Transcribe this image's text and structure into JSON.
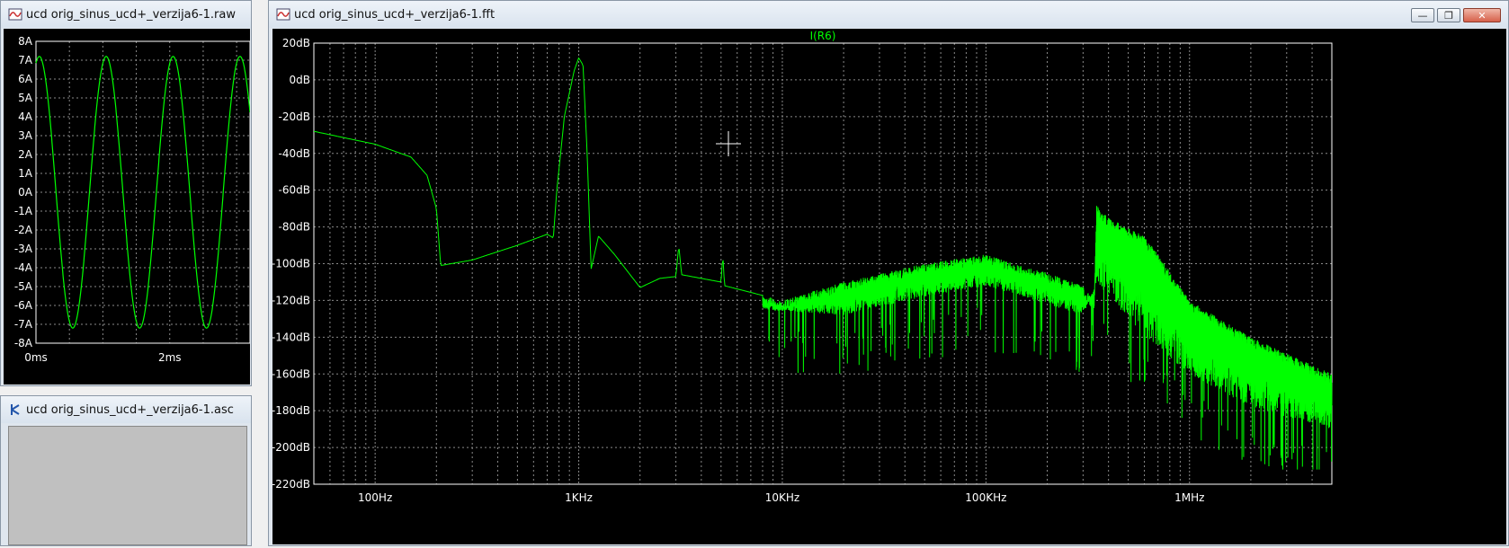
{
  "colors": {
    "trace": "#00ff00",
    "grid": "#8a8a8a",
    "axis_text": "#ffffff",
    "plot_bg": "#000000"
  },
  "windows": {
    "raw": {
      "title": "ucd orig_sinus_ucd+_verzija6-1.raw",
      "icon": "waveform-icon"
    },
    "asc": {
      "title": "ucd orig_sinus_ucd+_verzija6-1.asc",
      "icon": "schematic-icon"
    },
    "fft": {
      "title": "ucd orig_sinus_ucd+_verzija6-1.fft",
      "icon": "waveform-icon",
      "buttons": {
        "minimize": "minimize-button",
        "restore": "restore-button",
        "close": "close-button"
      }
    }
  },
  "chart_data": [
    {
      "type": "line",
      "window": "raw",
      "ylabel_ticks": [
        "8A",
        "7A",
        "6A",
        "5A",
        "4A",
        "3A",
        "2A",
        "1A",
        "0A",
        "-1A",
        "-2A",
        "-3A",
        "-4A",
        "-5A",
        "-6A",
        "-7A",
        "-8A"
      ],
      "xlabel_ticks": [
        "0ms",
        "2ms"
      ],
      "ylim": [
        -8,
        8
      ],
      "xlim": [
        0,
        3.2
      ],
      "series": [
        {
          "amplitude": 7.2,
          "period_ms": 1.0,
          "phase_peak_ms": 0.05
        }
      ]
    },
    {
      "type": "line",
      "window": "fft",
      "title": "I(R6)",
      "x_scale": "log",
      "xlim": [
        50,
        5000000
      ],
      "ylim": [
        -220,
        20
      ],
      "y_ticks": [
        "20dB",
        "0dB",
        "-20dB",
        "-40dB",
        "-60dB",
        "-80dB",
        "-100dB",
        "-120dB",
        "-140dB",
        "-160dB",
        "-180dB",
        "-200dB",
        "-220dB"
      ],
      "x_ticks": [
        "100Hz",
        "1KHz",
        "10KHz",
        "100KHz",
        "1MHz"
      ],
      "envelope": [
        [
          50,
          -28
        ],
        [
          100,
          -35
        ],
        [
          150,
          -42
        ],
        [
          180,
          -52
        ],
        [
          200,
          -70
        ],
        [
          210,
          -101
        ],
        [
          300,
          -98
        ],
        [
          500,
          -90
        ],
        [
          700,
          -84
        ],
        [
          750,
          -86
        ],
        [
          780,
          -60
        ],
        [
          850,
          -20
        ],
        [
          950,
          5
        ],
        [
          1000,
          12
        ],
        [
          1050,
          8
        ],
        [
          1100,
          -40
        ],
        [
          1150,
          -103
        ],
        [
          1250,
          -85
        ],
        [
          1500,
          -95
        ],
        [
          2000,
          -113
        ],
        [
          2500,
          -108
        ],
        [
          3000,
          -107
        ],
        [
          3100,
          -90
        ],
        [
          3200,
          -106
        ],
        [
          5000,
          -110
        ],
        [
          5100,
          -95
        ],
        [
          5200,
          -112
        ],
        [
          10000,
          -120
        ],
        [
          20000,
          -110
        ],
        [
          50000,
          -100
        ],
        [
          100000,
          -95
        ],
        [
          200000,
          -105
        ],
        [
          300000,
          -112
        ],
        [
          340000,
          -120
        ],
        [
          350000,
          -68
        ],
        [
          400000,
          -75
        ],
        [
          600000,
          -85
        ],
        [
          700000,
          -95
        ],
        [
          1000000,
          -120
        ],
        [
          2000000,
          -140
        ],
        [
          5000000,
          -160
        ]
      ],
      "noise_floor": [
        [
          8000,
          -125
        ],
        [
          20000,
          -128
        ],
        [
          50000,
          -118
        ],
        [
          100000,
          -112
        ],
        [
          200000,
          -122
        ],
        [
          300000,
          -128
        ],
        [
          350000,
          -110
        ],
        [
          600000,
          -140
        ],
        [
          1000000,
          -160
        ],
        [
          2000000,
          -178
        ],
        [
          5000000,
          -190
        ]
      ]
    }
  ]
}
